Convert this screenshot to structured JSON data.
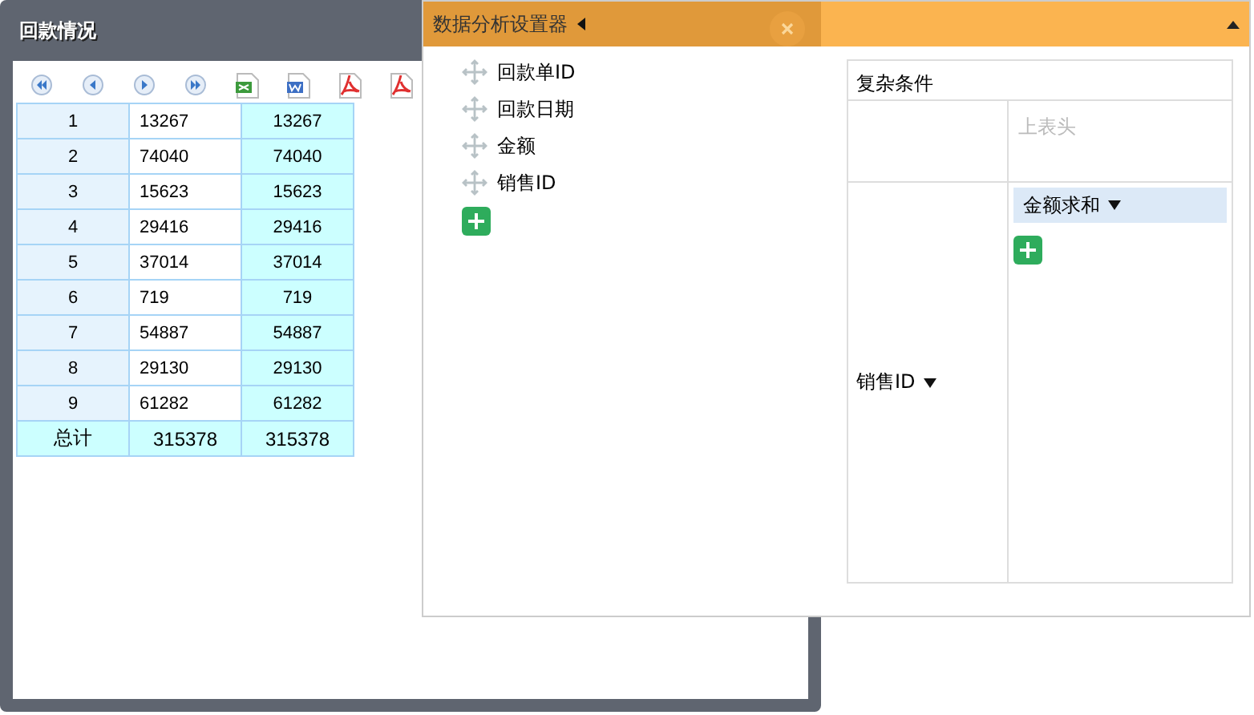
{
  "window": {
    "title": "回款情况"
  },
  "table": {
    "rows": [
      {
        "cells": [
          "1",
          "13267",
          "13267"
        ]
      },
      {
        "cells": [
          "2",
          "74040",
          "74040"
        ]
      },
      {
        "cells": [
          "3",
          "15623",
          "15623"
        ]
      },
      {
        "cells": [
          "4",
          "29416",
          "29416"
        ]
      },
      {
        "cells": [
          "5",
          "37014",
          "37014"
        ]
      },
      {
        "cells": [
          "6",
          "719",
          "719"
        ]
      },
      {
        "cells": [
          "7",
          "54887",
          "54887"
        ]
      },
      {
        "cells": [
          "8",
          "29130",
          "29130"
        ]
      },
      {
        "cells": [
          "9",
          "61282",
          "61282"
        ]
      }
    ],
    "total": {
      "cells": [
        "总计",
        "315378",
        "315378"
      ]
    }
  },
  "panel": {
    "title": "数据分析设置器",
    "fields": [
      "回款单ID",
      "回款日期",
      "金额",
      "销售ID"
    ],
    "grid": {
      "title": "复杂条件",
      "column_header_placeholder": "上表头",
      "row_field": "销售ID",
      "value_field": "金额求和"
    }
  }
}
